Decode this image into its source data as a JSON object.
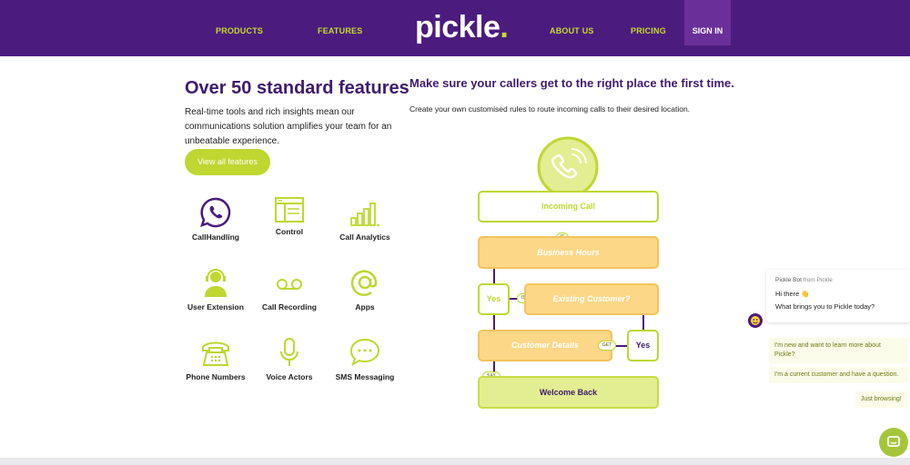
{
  "nav": {
    "items": [
      "PRODUCTS",
      "FEATURES",
      "ABOUT US",
      "PRICING"
    ],
    "sign_in": "SIGN IN",
    "logo": "pickle",
    "logo_dot": "."
  },
  "features": {
    "title": "Over 50 standard features",
    "description": "Real-time tools and rich insights mean our communications solution amplifies your team for an unbeatable experience.",
    "cta": "View all features",
    "items": [
      {
        "label": "CallHandling",
        "icon": "phone-chat-icon"
      },
      {
        "label": "Control",
        "icon": "window-icon"
      },
      {
        "label": "Call Analytics",
        "icon": "bars-icon"
      },
      {
        "label": "User Extension",
        "icon": "headset-user-icon"
      },
      {
        "label": "Call Recording",
        "icon": "voicemail-icon"
      },
      {
        "label": "Apps",
        "icon": "at-icon"
      },
      {
        "label": "Phone Numbers",
        "icon": "telephone-icon"
      },
      {
        "label": "Voice Actors",
        "icon": "microphone-icon"
      },
      {
        "label": "SMS Messaging",
        "icon": "sms-bubble-icon"
      }
    ]
  },
  "routing": {
    "title": "Make sure your callers get to the right place the first time.",
    "description": "Create your own customised rules to route incoming calls to their desired location.",
    "incoming": "Incoming Call",
    "if": "IF",
    "business_hours": "Business Hours",
    "yes_left": "Yes",
    "is": "IS",
    "existing_customer": "Existing Customer?",
    "customer_details": "Customer Details",
    "get": "GET",
    "yes_right": "Yes",
    "say": "SAY",
    "welcome_back": "Welcome Back"
  },
  "chat": {
    "bot_name": "Pickle Bot",
    "from": "from Pickle",
    "greeting": "Hi there 👋",
    "question": "What brings you to Pickle today?",
    "options": [
      "I'm new and want to learn more about Pickle?",
      "I'm a current customer and have a question.",
      "Just browsing!"
    ]
  },
  "colors": {
    "brand_purple": "#4b1c7d",
    "accent_green": "#bfd730",
    "flow_orange": "#fbd787"
  }
}
